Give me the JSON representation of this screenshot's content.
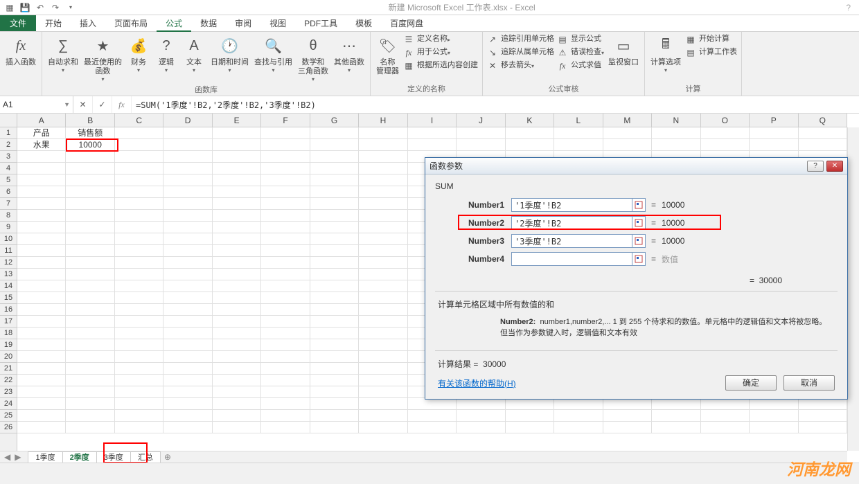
{
  "title": "新建 Microsoft Excel 工作表.xlsx - Excel",
  "tabs": {
    "file": "文件",
    "t1": "开始",
    "t2": "插入",
    "t3": "页面布局",
    "t4": "公式",
    "t5": "数据",
    "t6": "审阅",
    "t7": "视图",
    "t8": "PDF工具",
    "t9": "模板",
    "t10": "百度网盘"
  },
  "ribbon": {
    "insert_fn": "插入函数",
    "autosum": "自动求和",
    "recent": "最近使用的\n函数",
    "financial": "财务",
    "logical": "逻辑",
    "text_fn": "文本",
    "datetime": "日期和时间",
    "lookup": "查找与引用",
    "math": "数学和\n三角函数",
    "more_fn": "其他函数",
    "group_lib": "函数库",
    "name_mgr": "名称\n管理器",
    "def_name": "定义名称",
    "use_in_formula": "用于公式",
    "create_from_sel": "根据所选内容创建",
    "group_names": "定义的名称",
    "trace_prec": "追踪引用单元格",
    "trace_dep": "追踪从属单元格",
    "remove_arrows": "移去箭头",
    "show_formulas": "显示公式",
    "error_check": "错误检查",
    "eval_formula": "公式求值",
    "watch_window": "监视窗口",
    "group_audit": "公式审核",
    "calc_options": "计算选项",
    "calc_now": "开始计算",
    "calc_sheet": "计算工作表",
    "group_calc": "计算"
  },
  "namebox": "A1",
  "formula": "=SUM('1季度'!B2,'2季度'!B2,'3季度'!B2)",
  "columns": [
    "A",
    "B",
    "C",
    "D",
    "E",
    "F",
    "G",
    "H",
    "I",
    "J",
    "K",
    "L",
    "M",
    "N",
    "O",
    "P",
    "Q"
  ],
  "row_count": 26,
  "cells": {
    "A1": "产品",
    "B1": "销售额",
    "A2": "水果",
    "B2": "10000"
  },
  "sheets": {
    "s1": "1季度",
    "s2": "2季度",
    "s3": "3季度",
    "s4": "汇总"
  },
  "dialog": {
    "title": "函数参数",
    "fn": "SUM",
    "params": [
      {
        "label": "Number1",
        "value": "'1季度'!B2",
        "result": "10000"
      },
      {
        "label": "Number2",
        "value": "'2季度'!B2",
        "result": "10000"
      },
      {
        "label": "Number3",
        "value": "'3季度'!B2",
        "result": "10000"
      },
      {
        "label": "Number4",
        "value": "",
        "result": "数值"
      }
    ],
    "total_eq": "=",
    "total": "30000",
    "desc1": "计算单元格区域中所有数值的和",
    "desc2_label": "Number2:",
    "desc2_text": "number1,number2,...    1 到 255 个待求和的数值。单元格中的逻辑值和文本将被忽略。但当作为参数键入时，逻辑值和文本有效",
    "result_label": "计算结果 =",
    "result_value": "30000",
    "help": "有关该函数的帮助(H)",
    "ok": "确定",
    "cancel": "取消"
  },
  "watermark": "河南龙网"
}
